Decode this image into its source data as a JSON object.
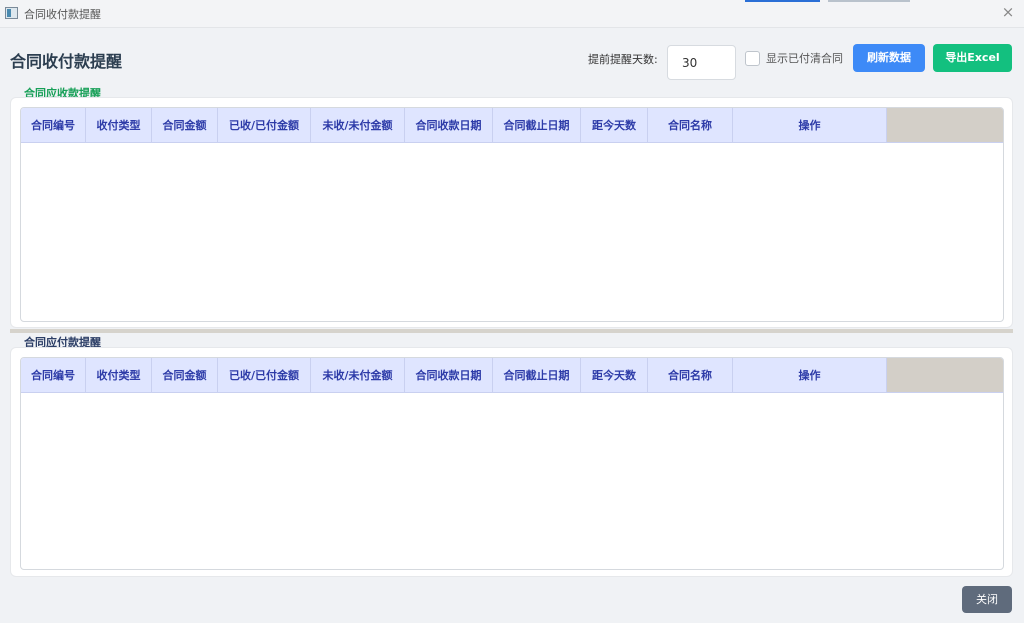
{
  "window": {
    "title": "合同收付款提醒",
    "close_glyph": "×"
  },
  "header": {
    "page_title": "合同收付款提醒",
    "days_label": "提前提醒天数:",
    "days_value": "30",
    "show_paid_label": "显示已付清合同",
    "refresh_label": "刷新数据",
    "export_label": "导出Excel"
  },
  "receivable": {
    "title": "合同应收款提醒",
    "columns": [
      "合同编号",
      "收付类型",
      "合同金额",
      "已收/已付金额",
      "未收/未付金额",
      "合同收款日期",
      "合同截止日期",
      "距今天数",
      "合同名称",
      "操作"
    ]
  },
  "payable": {
    "title": "合同应付款提醒",
    "columns": [
      "合同编号",
      "收付类型",
      "合同金额",
      "已收/已付金额",
      "未收/未付金额",
      "合同收款日期",
      "合同截止日期",
      "距今天数",
      "合同名称",
      "操作"
    ]
  },
  "footer": {
    "close_label": "关闭"
  },
  "colors": {
    "primary": "#3d8af7",
    "success": "#13c07f",
    "header_bg": "#dfe5ff",
    "header_text": "#2d3ba8",
    "close_btn": "#5f6b7c"
  }
}
